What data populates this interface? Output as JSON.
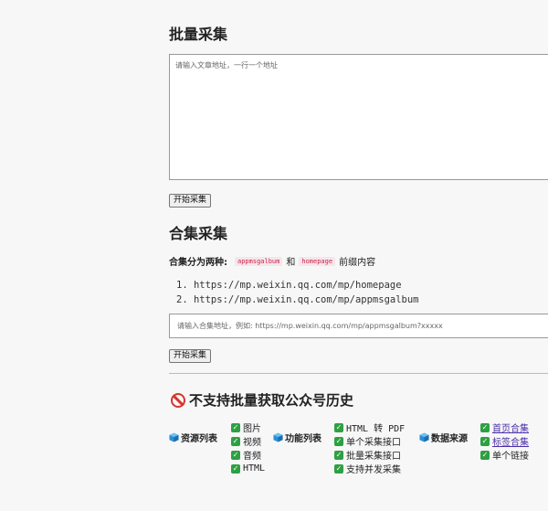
{
  "batch": {
    "title": "批量采集",
    "textarea_placeholder": "请输入文章地址，一行一个地址",
    "button_label": "开始采集"
  },
  "collection": {
    "title": "合集采集",
    "desc_label": "合集分为两种:",
    "code1": "appmsgalbum",
    "and_text": "和",
    "code2": "homepage",
    "suffix_text": "前缀内容",
    "urls": [
      "1. https://mp.weixin.qq.com/mp/homepage",
      "2. https://mp.weixin.qq.com/mp/appmsgalbum"
    ],
    "input_placeholder": "请输入合集地址，例如: https://mp.weixin.qq.com/mp/appmsgalbum?xxxxx",
    "button_label": "开始采集"
  },
  "notice": {
    "title": "不支持批量获取公众号历史",
    "icon": "prohibited-icon"
  },
  "features": {
    "resources": {
      "label": "资源列表",
      "items": [
        "图片",
        "视频",
        "音频",
        "HTML"
      ]
    },
    "functions": {
      "label": "功能列表",
      "items": [
        "HTML 转 PDF",
        "单个采集接口",
        "批量采集接口",
        "支持并发采集"
      ]
    },
    "sources": {
      "label": "数据来源",
      "items": [
        "首页合集",
        "标签合集",
        "单个链接"
      ]
    }
  },
  "colors": {
    "check": "#2ea043",
    "prohibited": "#d9342b",
    "cube": "#2b8fd6",
    "link": "#4a2fa8"
  }
}
